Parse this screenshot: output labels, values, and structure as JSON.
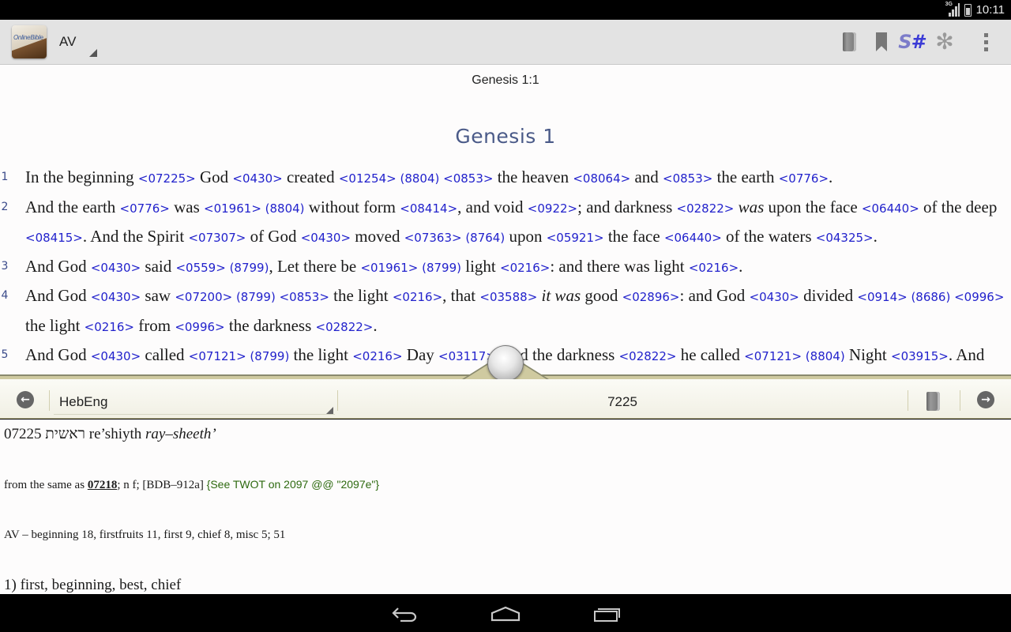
{
  "status_bar": {
    "network": "3G",
    "time": "10:11"
  },
  "action_bar": {
    "app_logo_text": "OnlineBible",
    "version": "AV",
    "icons": [
      "book-icon",
      "bookmark-icon",
      "strongs-numbers-icon",
      "asterisk-icon",
      "overflow-menu-icon"
    ],
    "strongs_label_s": "S",
    "strongs_label_hash": "#"
  },
  "bible": {
    "reference": "Genesis 1:1",
    "chapter_heading": "Genesis 1",
    "verses": [
      {
        "number": "1"
      },
      {
        "number": "2"
      },
      {
        "number": "3"
      },
      {
        "number": "4"
      },
      {
        "number": "5"
      }
    ]
  },
  "lexicon_bar": {
    "lexicon": "HebEng",
    "number": "7225",
    "icons": [
      "back-arrow-icon",
      "book-icon",
      "forward-arrow-icon"
    ]
  },
  "lexicon": {
    "entry_number": "07225",
    "hebrew": "ראשית",
    "transliteration": "re’shiyth",
    "pronunciation": "ray–sheeth’",
    "derivation_prefix": "from the same as",
    "derivation_ref": "07218",
    "derivation_rest": "; n f; [BDB–912a]",
    "twot": "{See TWOT on 2097 @@ \"2097e\"}",
    "av_usage": "AV – beginning 18, firstfruits 11, first 9, chief 8, misc 5; 51",
    "definition": "1) first, beginning, best, chief"
  },
  "nav_bar": {
    "icons": [
      "back-icon",
      "home-icon",
      "recent-apps-icon"
    ]
  },
  "colors": {
    "strongs_link": "#2222cc",
    "heading": "#4a5a88",
    "twot": "#2e6a10",
    "splitter": "#cfcaa0"
  }
}
